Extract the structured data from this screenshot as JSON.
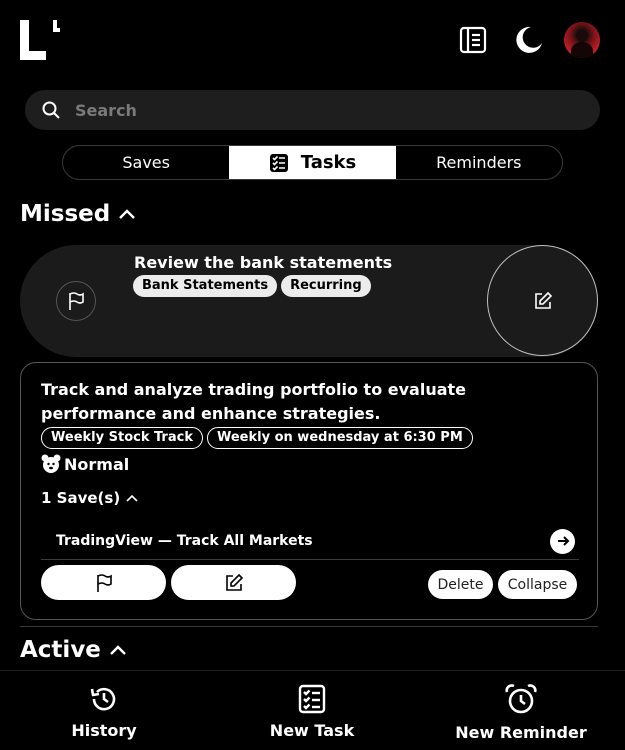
{
  "header": {
    "logo": "logo-mark",
    "icons": [
      "notebook-icon",
      "moon-icon"
    ],
    "avatar": "user-avatar"
  },
  "search": {
    "placeholder": "Search"
  },
  "tabs": [
    {
      "label": "Saves",
      "active": false
    },
    {
      "label": "Tasks",
      "active": true,
      "icon": "checklist-icon"
    },
    {
      "label": "Reminders",
      "active": false
    }
  ],
  "sections": {
    "missed": "Missed",
    "active": "Active"
  },
  "missed_tasks": [
    {
      "title": "Review the bank statements",
      "tags": [
        "Bank Statements",
        "Recurring"
      ]
    }
  ],
  "expanded_task": {
    "title": "Track and analyze trading portfolio to evaluate performance and enhance strategies.",
    "tags": [
      "Weekly Stock Track",
      "Weekly on wednesday at 6:30 PM"
    ],
    "priority": "Normal",
    "saves_count": "1 Save(s)",
    "saves": [
      {
        "name": "TradingView — Track All Markets"
      }
    ],
    "actions": {
      "delete": "Delete",
      "collapse": "Collapse"
    }
  },
  "bottom_nav": [
    {
      "label": "History",
      "icon": "history-icon"
    },
    {
      "label": "New Task",
      "icon": "new-task-icon"
    },
    {
      "label": "New Reminder",
      "icon": "alarm-clock-icon"
    }
  ],
  "colors": {
    "background": "#000000",
    "card": "#1b1b1b",
    "search_bg": "#1e1e1e",
    "accent": "#ffffff"
  }
}
